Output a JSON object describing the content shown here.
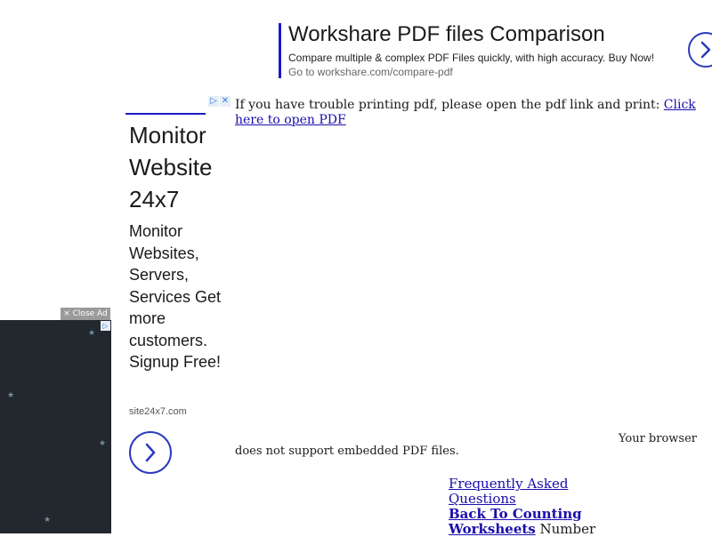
{
  "top_ad": {
    "title": "Workshare PDF files Comparison",
    "description": "Compare multiple & complex PDF Files quickly, with high accuracy. Buy Now!",
    "url": "Go to workshare.com/compare-pdf",
    "arrow_icon": "chevron-right-icon"
  },
  "side_ad": {
    "heading": "Monitor Website 24x7",
    "body": "Monitor Websites, Servers, Services Get more customers. Signup Free!",
    "domain": "site24x7.com",
    "adchoice_icon": "▷",
    "close_icon": "✕"
  },
  "floating_ad": {
    "close_label": "× Close Ad",
    "adchoice_icon": "▷"
  },
  "main": {
    "print_note": "If you have trouble printing pdf, please open the pdf link and print: ",
    "print_link": "Click here to open PDF",
    "browser_note_part1": "Your browser",
    "browser_note_part2": "does not support embedded PDF files.",
    "faq_link": "Frequently Asked Questions",
    "back_link": "Back To Counting Worksheets",
    "trailing_text": "Number"
  },
  "colors": {
    "ad_accent": "#1a1ac4",
    "link": "#1a0dab",
    "dark_ad_bg": "#23282e"
  }
}
